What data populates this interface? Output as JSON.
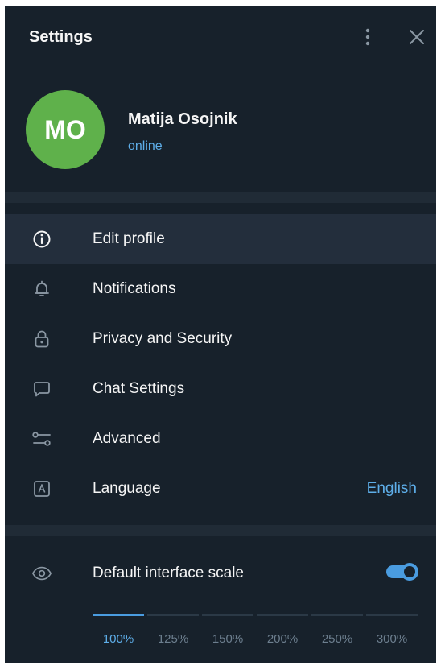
{
  "header": {
    "title": "Settings",
    "more_icon": "vertical-dots-icon",
    "close_icon": "close-icon"
  },
  "profile": {
    "initials": "MO",
    "avatar_color": "#5fb14b",
    "name": "Matija Osojnik",
    "status": "online"
  },
  "menu": {
    "items": [
      {
        "label": "Edit profile",
        "icon": "info-icon",
        "active": true
      },
      {
        "label": "Notifications",
        "icon": "bell-icon"
      },
      {
        "label": "Privacy and Security",
        "icon": "lock-icon"
      },
      {
        "label": "Chat Settings",
        "icon": "chat-bubble-icon"
      },
      {
        "label": "Advanced",
        "icon": "sliders-icon"
      },
      {
        "label": "Language",
        "icon": "language-icon",
        "value": "English"
      }
    ]
  },
  "scale": {
    "label": "Default interface scale",
    "icon": "eye-icon",
    "enabled": true,
    "options": [
      "100%",
      "125%",
      "150%",
      "200%",
      "250%",
      "300%"
    ],
    "selected": "100%"
  },
  "colors": {
    "background": "#17212b",
    "accent": "#5eaee9",
    "separator": "#202b36",
    "active_row": "#232e3c"
  }
}
